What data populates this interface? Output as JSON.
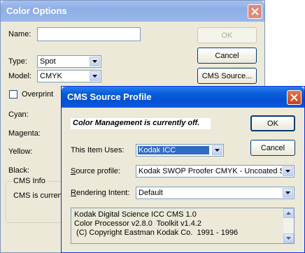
{
  "color_options": {
    "title": "Color Options",
    "name_label": "Name:",
    "name_value": "",
    "type_label": "Type:",
    "type_value": "Spot",
    "model_label": "Model:",
    "model_value": "CMYK",
    "overprint_label": "Overprint",
    "cyan_label": "Cyan:",
    "magenta_label": "Magenta:",
    "yellow_label": "Yellow:",
    "black_label": "Black:",
    "cms_info_title": "CMS Info",
    "cms_info_text": "CMS is current",
    "ok_label": "OK",
    "cancel_label": "Cancel",
    "cms_source_label": "CMS Source..."
  },
  "cms_source_profile": {
    "title": "CMS Source Profile",
    "banner": "Color Management is currently off.",
    "ok_label": "OK",
    "cancel_label": "Cancel",
    "item_uses_label": "This Item Uses:",
    "item_uses_value": "Kodak ICC",
    "source_profile_prefix": "S",
    "source_profile_rest": "ource profile:",
    "source_profile_value": "Kodak SWOP Proofer CMYK - Uncoated St",
    "rendering_prefix": "R",
    "rendering_rest": "endering Intent:",
    "rendering_value": "Default",
    "info_lines": [
      "Kodak Digital Science ICC CMS 1.0",
      "Color Processor v2.8.0  Toolkit v1.4.2",
      " (C) Copyright Eastman Kodak Co.  1991 - 1996"
    ]
  },
  "colors": {
    "titlebar_active": "#0a5fd8",
    "titlebar_inactive": "#9db9eb",
    "close_active": "#e0542a",
    "selection": "#316ac5"
  }
}
